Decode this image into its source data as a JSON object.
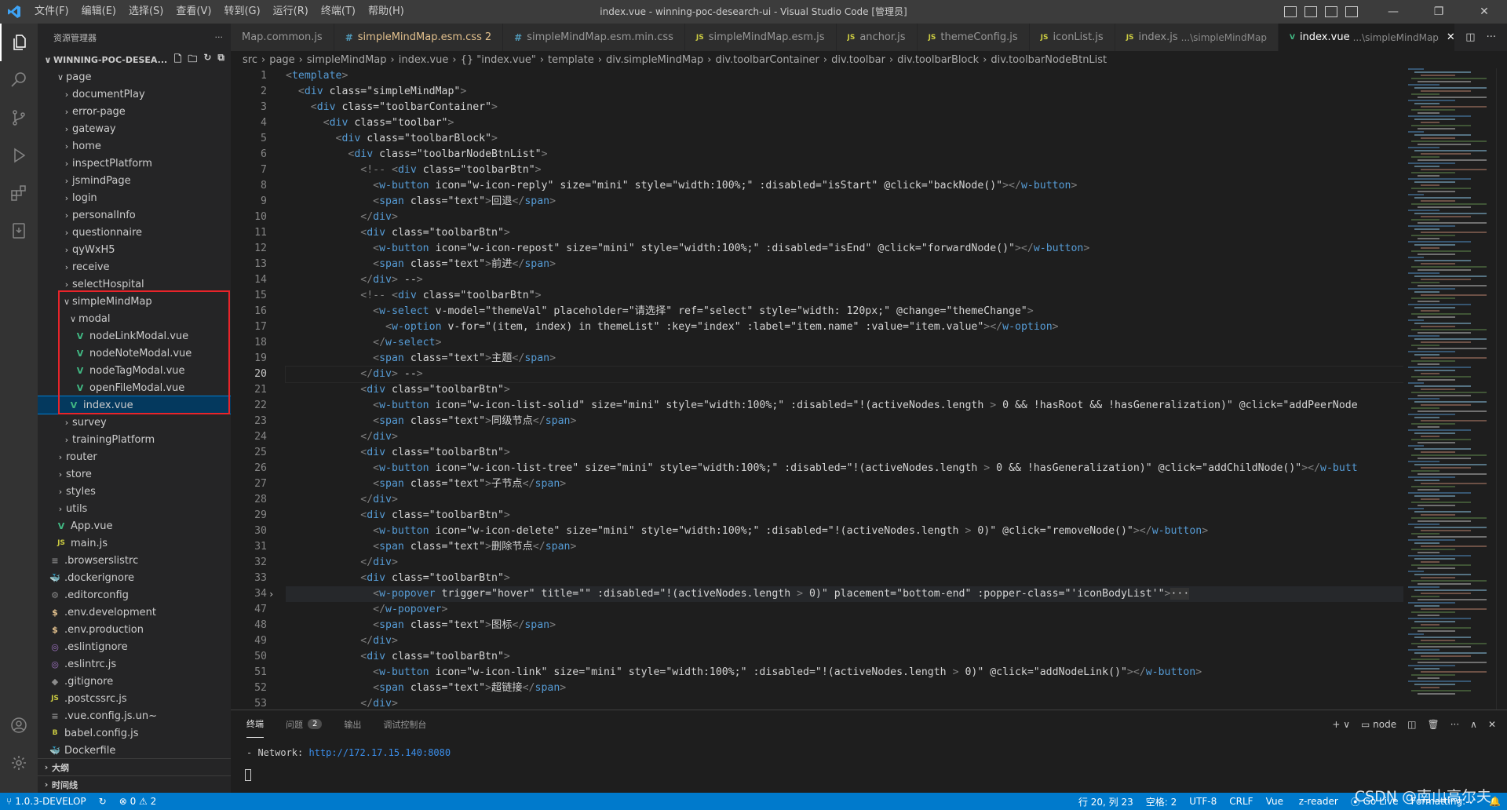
{
  "window": {
    "menu": [
      "文件(F)",
      "编辑(E)",
      "选择(S)",
      "查看(V)",
      "转到(G)",
      "运行(R)",
      "终端(T)",
      "帮助(H)"
    ],
    "title": "index.vue - winning-poc-desearch-ui - Visual Studio Code [管理员]"
  },
  "sidebar": {
    "title": "资源管理器",
    "root": "WINNING-POC-DESEA...",
    "items": [
      {
        "label": "page",
        "depth": 1,
        "kind": "folder-open"
      },
      {
        "label": "documentPlay",
        "depth": 2,
        "kind": "folder"
      },
      {
        "label": "error-page",
        "depth": 2,
        "kind": "folder"
      },
      {
        "label": "gateway",
        "depth": 2,
        "kind": "folder"
      },
      {
        "label": "home",
        "depth": 2,
        "kind": "folder"
      },
      {
        "label": "inspectPlatform",
        "depth": 2,
        "kind": "folder"
      },
      {
        "label": "jsmindPage",
        "depth": 2,
        "kind": "folder"
      },
      {
        "label": "login",
        "depth": 2,
        "kind": "folder"
      },
      {
        "label": "personalInfo",
        "depth": 2,
        "kind": "folder"
      },
      {
        "label": "questionnaire",
        "depth": 2,
        "kind": "folder"
      },
      {
        "label": "qyWxH5",
        "depth": 2,
        "kind": "folder"
      },
      {
        "label": "receive",
        "depth": 2,
        "kind": "folder"
      },
      {
        "label": "selectHospital",
        "depth": 2,
        "kind": "folder"
      },
      {
        "label": "simpleMindMap",
        "depth": 2,
        "kind": "folder-open"
      },
      {
        "label": "modal",
        "depth": 3,
        "kind": "folder-open"
      },
      {
        "label": "nodeLinkModal.vue",
        "depth": 4,
        "kind": "vue"
      },
      {
        "label": "nodeNoteModal.vue",
        "depth": 4,
        "kind": "vue"
      },
      {
        "label": "nodeTagModal.vue",
        "depth": 4,
        "kind": "vue"
      },
      {
        "label": "openFileModal.vue",
        "depth": 4,
        "kind": "vue"
      },
      {
        "label": "index.vue",
        "depth": 3,
        "kind": "vue",
        "selected": true
      },
      {
        "label": "survey",
        "depth": 2,
        "kind": "folder"
      },
      {
        "label": "trainingPlatform",
        "depth": 2,
        "kind": "folder"
      },
      {
        "label": "router",
        "depth": 1,
        "kind": "folder"
      },
      {
        "label": "store",
        "depth": 1,
        "kind": "folder"
      },
      {
        "label": "styles",
        "depth": 1,
        "kind": "folder"
      },
      {
        "label": "utils",
        "depth": 1,
        "kind": "folder"
      },
      {
        "label": "App.vue",
        "depth": 1,
        "kind": "vue"
      },
      {
        "label": "main.js",
        "depth": 1,
        "kind": "js"
      },
      {
        "label": ".browserslistrc",
        "depth": 0,
        "kind": "gen"
      },
      {
        "label": ".dockerignore",
        "depth": 0,
        "kind": "docker"
      },
      {
        "label": ".editorconfig",
        "depth": 0,
        "kind": "gear"
      },
      {
        "label": ".env.development",
        "depth": 0,
        "kind": "env"
      },
      {
        "label": ".env.production",
        "depth": 0,
        "kind": "env"
      },
      {
        "label": ".eslintignore",
        "depth": 0,
        "kind": "lint"
      },
      {
        "label": ".eslintrc.js",
        "depth": 0,
        "kind": "lint"
      },
      {
        "label": ".gitignore",
        "depth": 0,
        "kind": "git"
      },
      {
        "label": ".postcssrc.js",
        "depth": 0,
        "kind": "js"
      },
      {
        "label": ".vue.config.js.un~",
        "depth": 0,
        "kind": "gen"
      },
      {
        "label": "babel.config.js",
        "depth": 0,
        "kind": "babel"
      },
      {
        "label": "Dockerfile",
        "depth": 0,
        "kind": "docker"
      }
    ],
    "sections": [
      "大纲",
      "时间线"
    ]
  },
  "tabs": [
    {
      "label": "Map.common.js",
      "icon": "",
      "active": false
    },
    {
      "label": "simpleMindMap.esm.css",
      "icon": "#",
      "badge": "2",
      "active": false,
      "highlight": true
    },
    {
      "label": "simpleMindMap.esm.min.css",
      "icon": "#",
      "active": false
    },
    {
      "label": "simpleMindMap.esm.js",
      "icon": "JS",
      "active": false
    },
    {
      "label": "anchor.js",
      "icon": "JS",
      "active": false
    },
    {
      "label": "themeConfig.js",
      "icon": "JS",
      "active": false
    },
    {
      "label": "iconList.js",
      "icon": "JS",
      "active": false
    },
    {
      "label": "index.js",
      "icon": "JS",
      "suffix": "...\\simpleMindMap",
      "active": false
    },
    {
      "label": "index.vue",
      "icon": "V",
      "suffix": "...\\simpleMindMap",
      "active": true
    }
  ],
  "breadcrumb": [
    "src",
    "page",
    "simpleMindMap",
    "index.vue",
    "{} \"index.vue\"",
    "template",
    "div.simpleMindMap",
    "div.toolbarContainer",
    "div.toolbar",
    "div.toolbarBlock",
    "div.toolbarNodeBtnList"
  ],
  "editor": {
    "line_numbers": [
      "1",
      "2",
      "3",
      "4",
      "5",
      "6",
      "7",
      "8",
      "9",
      "10",
      "11",
      "12",
      "13",
      "14",
      "15",
      "16",
      "17",
      "18",
      "19",
      "20",
      "21",
      "22",
      "23",
      "24",
      "25",
      "26",
      "27",
      "28",
      "29",
      "30",
      "31",
      "32",
      "33",
      "34",
      "47",
      "48",
      "49",
      "50",
      "51",
      "52",
      "53"
    ],
    "current_line": "20",
    "lines": [
      "<template>",
      "  <div class=\"simpleMindMap\">",
      "    <div class=\"toolbarContainer\">",
      "      <div class=\"toolbar\">",
      "        <div class=\"toolbarBlock\">",
      "          <div class=\"toolbarNodeBtnList\">",
      "            <!-- <div class=\"toolbarBtn\">",
      "              <w-button icon=\"w-icon-reply\" size=\"mini\" style=\"width:100%;\" :disabled=\"isStart\" @click=\"backNode()\"></w-button>",
      "              <span class=\"text\">回退</span>",
      "            </div>",
      "            <div class=\"toolbarBtn\">",
      "              <w-button icon=\"w-icon-repost\" size=\"mini\" style=\"width:100%;\" :disabled=\"isEnd\" @click=\"forwardNode()\"></w-button>",
      "              <span class=\"text\">前进</span>",
      "            </div> -->",
      "            <!-- <div class=\"toolbarBtn\">",
      "              <w-select v-model=\"themeVal\" placeholder=\"请选择\" ref=\"select\" style=\"width: 120px;\" @change=\"themeChange\">",
      "                <w-option v-for=\"(item, index) in themeList\" :key=\"index\" :label=\"item.name\" :value=\"item.value\"></w-option>",
      "              </w-select>",
      "              <span class=\"text\">主题</span>",
      "            </div> -->",
      "            <div class=\"toolbarBtn\">",
      "              <w-button icon=\"w-icon-list-solid\" size=\"mini\" style=\"width:100%;\" :disabled=\"!(activeNodes.length > 0 && !hasRoot && !hasGeneralization)\" @click=\"addPeerNode",
      "              <span class=\"text\">同级节点</span>",
      "            </div>",
      "            <div class=\"toolbarBtn\">",
      "              <w-button icon=\"w-icon-list-tree\" size=\"mini\" style=\"width:100%;\" :disabled=\"!(activeNodes.length > 0 && !hasGeneralization)\" @click=\"addChildNode()\"></w-butt",
      "              <span class=\"text\">子节点</span>",
      "            </div>",
      "            <div class=\"toolbarBtn\">",
      "              <w-button icon=\"w-icon-delete\" size=\"mini\" style=\"width:100%;\" :disabled=\"!(activeNodes.length > 0)\" @click=\"removeNode()\"></w-button>",
      "              <span class=\"text\">删除节点</span>",
      "            </div>",
      "            <div class=\"toolbarBtn\">",
      "              <w-popover trigger=\"hover\" title=\"\" :disabled=\"!(activeNodes.length > 0)\" placement=\"bottom-end\" :popper-class=\"'iconBodyList'\">···",
      "              </w-popover>",
      "              <span class=\"text\">图标</span>",
      "            </div>",
      "            <div class=\"toolbarBtn\">",
      "              <w-button icon=\"w-icon-link\" size=\"mini\" style=\"width:100%;\" :disabled=\"!(activeNodes.length > 0)\" @click=\"addNodeLink()\"></w-button>",
      "              <span class=\"text\">超链接</span>",
      "            </div>"
    ]
  },
  "panel": {
    "tabs": [
      "终端",
      "问题",
      "输出",
      "调试控制台"
    ],
    "problems_count": "2",
    "terminal_profile": "node",
    "network_label": "- Network: ",
    "network_url": "http://172.17.15.140:8080"
  },
  "statusbar": {
    "branch": "1.0.3-DEVELOP",
    "errors": "0",
    "warnings": "2",
    "position": "行 20, 列 23",
    "spaces": "空格: 2",
    "encoding": "UTF-8",
    "eol": "CRLF",
    "language": "Vue",
    "extension": "z-reader",
    "golive": "Go Live",
    "formatting": "Formatting: ✓"
  },
  "watermark": "CSDN @南山高尔夫",
  "colors": {
    "accent": "#007acc",
    "selection_box": "#e8242a",
    "vue": "#41b883",
    "js": "#cbcb41"
  }
}
